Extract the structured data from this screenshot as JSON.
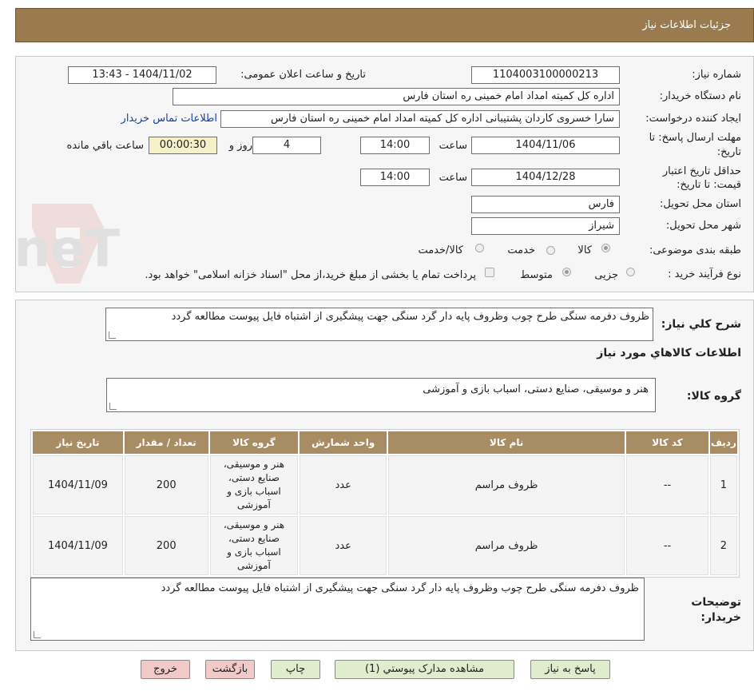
{
  "header": {
    "title": "جزئیات اطلاعات نیاز"
  },
  "watermark": {
    "text": "AriaTender.neT"
  },
  "form": {
    "need_number_label": "شماره نیاز:",
    "need_number": "1104003100000213",
    "announce_label": "تاریخ و ساعت اعلان عمومی:",
    "announce_value": "1404/11/02 - 13:43",
    "buyer_org_label": "نام دستگاه خریدار:",
    "buyer_org": "اداره کل کمیته امداد امام خمینی  ره  استان فارس",
    "creator_label": "ایجاد کننده درخواست:",
    "creator": "سارا خسروی کاردان پشتیبانی  اداره کل کمیته امداد امام خمینی  ره  استان فارس",
    "contact_link": "اطلاعات تماس خریدار",
    "deadline_label_1": "مهلت ارسال پاسخ: تا",
    "deadline_label_2": "تاریخ:",
    "deadline_date": "1404/11/06",
    "time_label": "ساعت",
    "deadline_time": "14:00",
    "days_value": "4",
    "days_label": "روز و",
    "remaining_time": "00:00:30",
    "remaining_label": "ساعت باقي مانده",
    "validity_label_1": "حداقل تاريخ اعتبار",
    "validity_label_2": "قیمت: تا تاریخ:",
    "validity_date": "1404/12/28",
    "validity_time": "14:00",
    "province_label": "استان محل تحویل:",
    "province": "فارس",
    "city_label": "شهر محل تحویل:",
    "city": "شیراز",
    "category_label": "طبقه بندی موضوعی:",
    "category_options": [
      "کالا",
      "خدمت",
      "کالا/خدمت"
    ],
    "category_selected": "کالا",
    "process_label": "نوع فرآیند خرید :",
    "process_options": [
      "جزیی",
      "متوسط"
    ],
    "process_selected": "متوسط",
    "payment_note": "پرداخت تمام یا بخشی از مبلغ خرید،از محل \"اسناد خزانه اسلامی\" خواهد بود."
  },
  "summary": {
    "description_label": "شرح کلي نياز:",
    "description": "ظروف دفرمه سنگی طرح چوب وظروف پایه دار گرد سنگی جهت پیشگیری از اشتباه فایل پیوست مطالعه گردد",
    "items_title": "اطلاعات کالاهاي مورد نياز",
    "goods_group_label": "گروه کالا:",
    "goods_group": "هنر و موسیقی، صنایع دستی، اسباب بازی و آموزشی"
  },
  "table": {
    "headers": [
      "ردیف",
      "کد کالا",
      "نام کالا",
      "واحد شمارش",
      "گروه کالا",
      "تعداد / مقدار",
      "تاریخ نیاز"
    ],
    "rows": [
      {
        "row": "1",
        "code": "--",
        "name": "ظروف مراسم",
        "unit": "عدد",
        "group": "هنر و موسیقی، صنایع دستی، اسباب بازی و آموزشی",
        "qty": "200",
        "date": "1404/11/09"
      },
      {
        "row": "2",
        "code": "--",
        "name": "ظروف مراسم",
        "unit": "عدد",
        "group": "هنر و موسیقی، صنایع دستی، اسباب بازی و آموزشی",
        "qty": "200",
        "date": "1404/11/09"
      }
    ]
  },
  "buyer_notes": {
    "label_1": "توضیحات",
    "label_2": "خریدار:",
    "text": "ظروف دفرمه سنگی طرح چوب وظروف پایه دار گرد سنگی جهت پیشگیری از اشتباه فایل پیوست مطالعه گردد"
  },
  "buttons": {
    "reply": "پاسخ به نیاز",
    "attachments": "مشاهده مدارک پیوستي (1)",
    "print": "چاپ",
    "back": "بازگشت",
    "exit": "خروج"
  },
  "colors": {
    "header_bg": "#9a7b4f",
    "table_header": "#a88c63",
    "link": "#1a3f9c"
  }
}
